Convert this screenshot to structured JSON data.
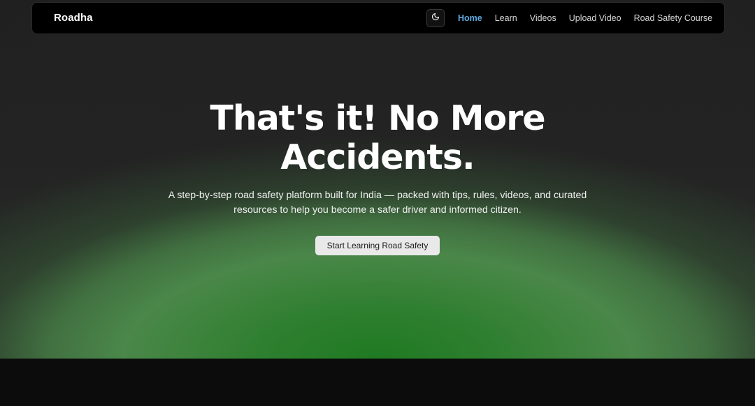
{
  "nav": {
    "brand": "Roadha",
    "theme_toggle_icon": "moon-icon",
    "links": [
      {
        "label": "Home",
        "active": true
      },
      {
        "label": "Learn",
        "active": false
      },
      {
        "label": "Videos",
        "active": false
      },
      {
        "label": "Upload Video",
        "active": false
      },
      {
        "label": "Road Safety Course",
        "active": false
      }
    ]
  },
  "hero": {
    "headline_line1": "That's it! No More",
    "headline_line2": "Accidents.",
    "subtitle_line1": "A step-by-step road safety platform built for India — packed with tips, rules, videos, and curated",
    "subtitle_line2": "resources to help you become a safer driver and informed citizen.",
    "cta_label": "Start Learning Road Safety"
  },
  "colors": {
    "accent_active_link": "#5ea7dc",
    "hero_glow": "#2e7f2f",
    "background": "#0c0c0c"
  }
}
